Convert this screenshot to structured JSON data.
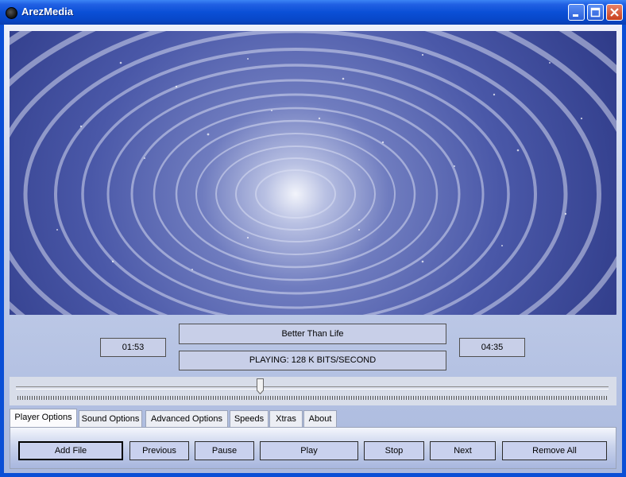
{
  "window": {
    "title": "ArezMedia"
  },
  "titlebar": {
    "minimize_icon": "minimize-icon",
    "maximize_icon": "maximize-icon",
    "close_icon": "close-icon"
  },
  "colors": {
    "titlebar": "#0a4fd6",
    "video_base": "#3f4c9e",
    "display_bg": "#c8cfe8",
    "button_bg": "#c9d1ee"
  },
  "video": {
    "description_icon": "visualization"
  },
  "display": {
    "elapsed_time": "01:53",
    "total_time": "04:35",
    "track_title": "Better Than Life",
    "status": "PLAYING: 128 K BITS/SECOND"
  },
  "seek": {
    "progress": 0.41
  },
  "tabs": [
    {
      "label": "Player Options",
      "active": true
    },
    {
      "label": "Sound Options",
      "active": false
    },
    {
      "label": "Advanced Options",
      "active": false
    },
    {
      "label": "Speeds",
      "active": false
    },
    {
      "label": "Xtras",
      "active": false
    },
    {
      "label": "About",
      "active": false
    }
  ],
  "buttons": {
    "add_file": "Add File",
    "previous": "Previous",
    "pause": "Pause",
    "play": "Play",
    "stop": "Stop",
    "next": "Next",
    "remove_all": "Remove All"
  }
}
